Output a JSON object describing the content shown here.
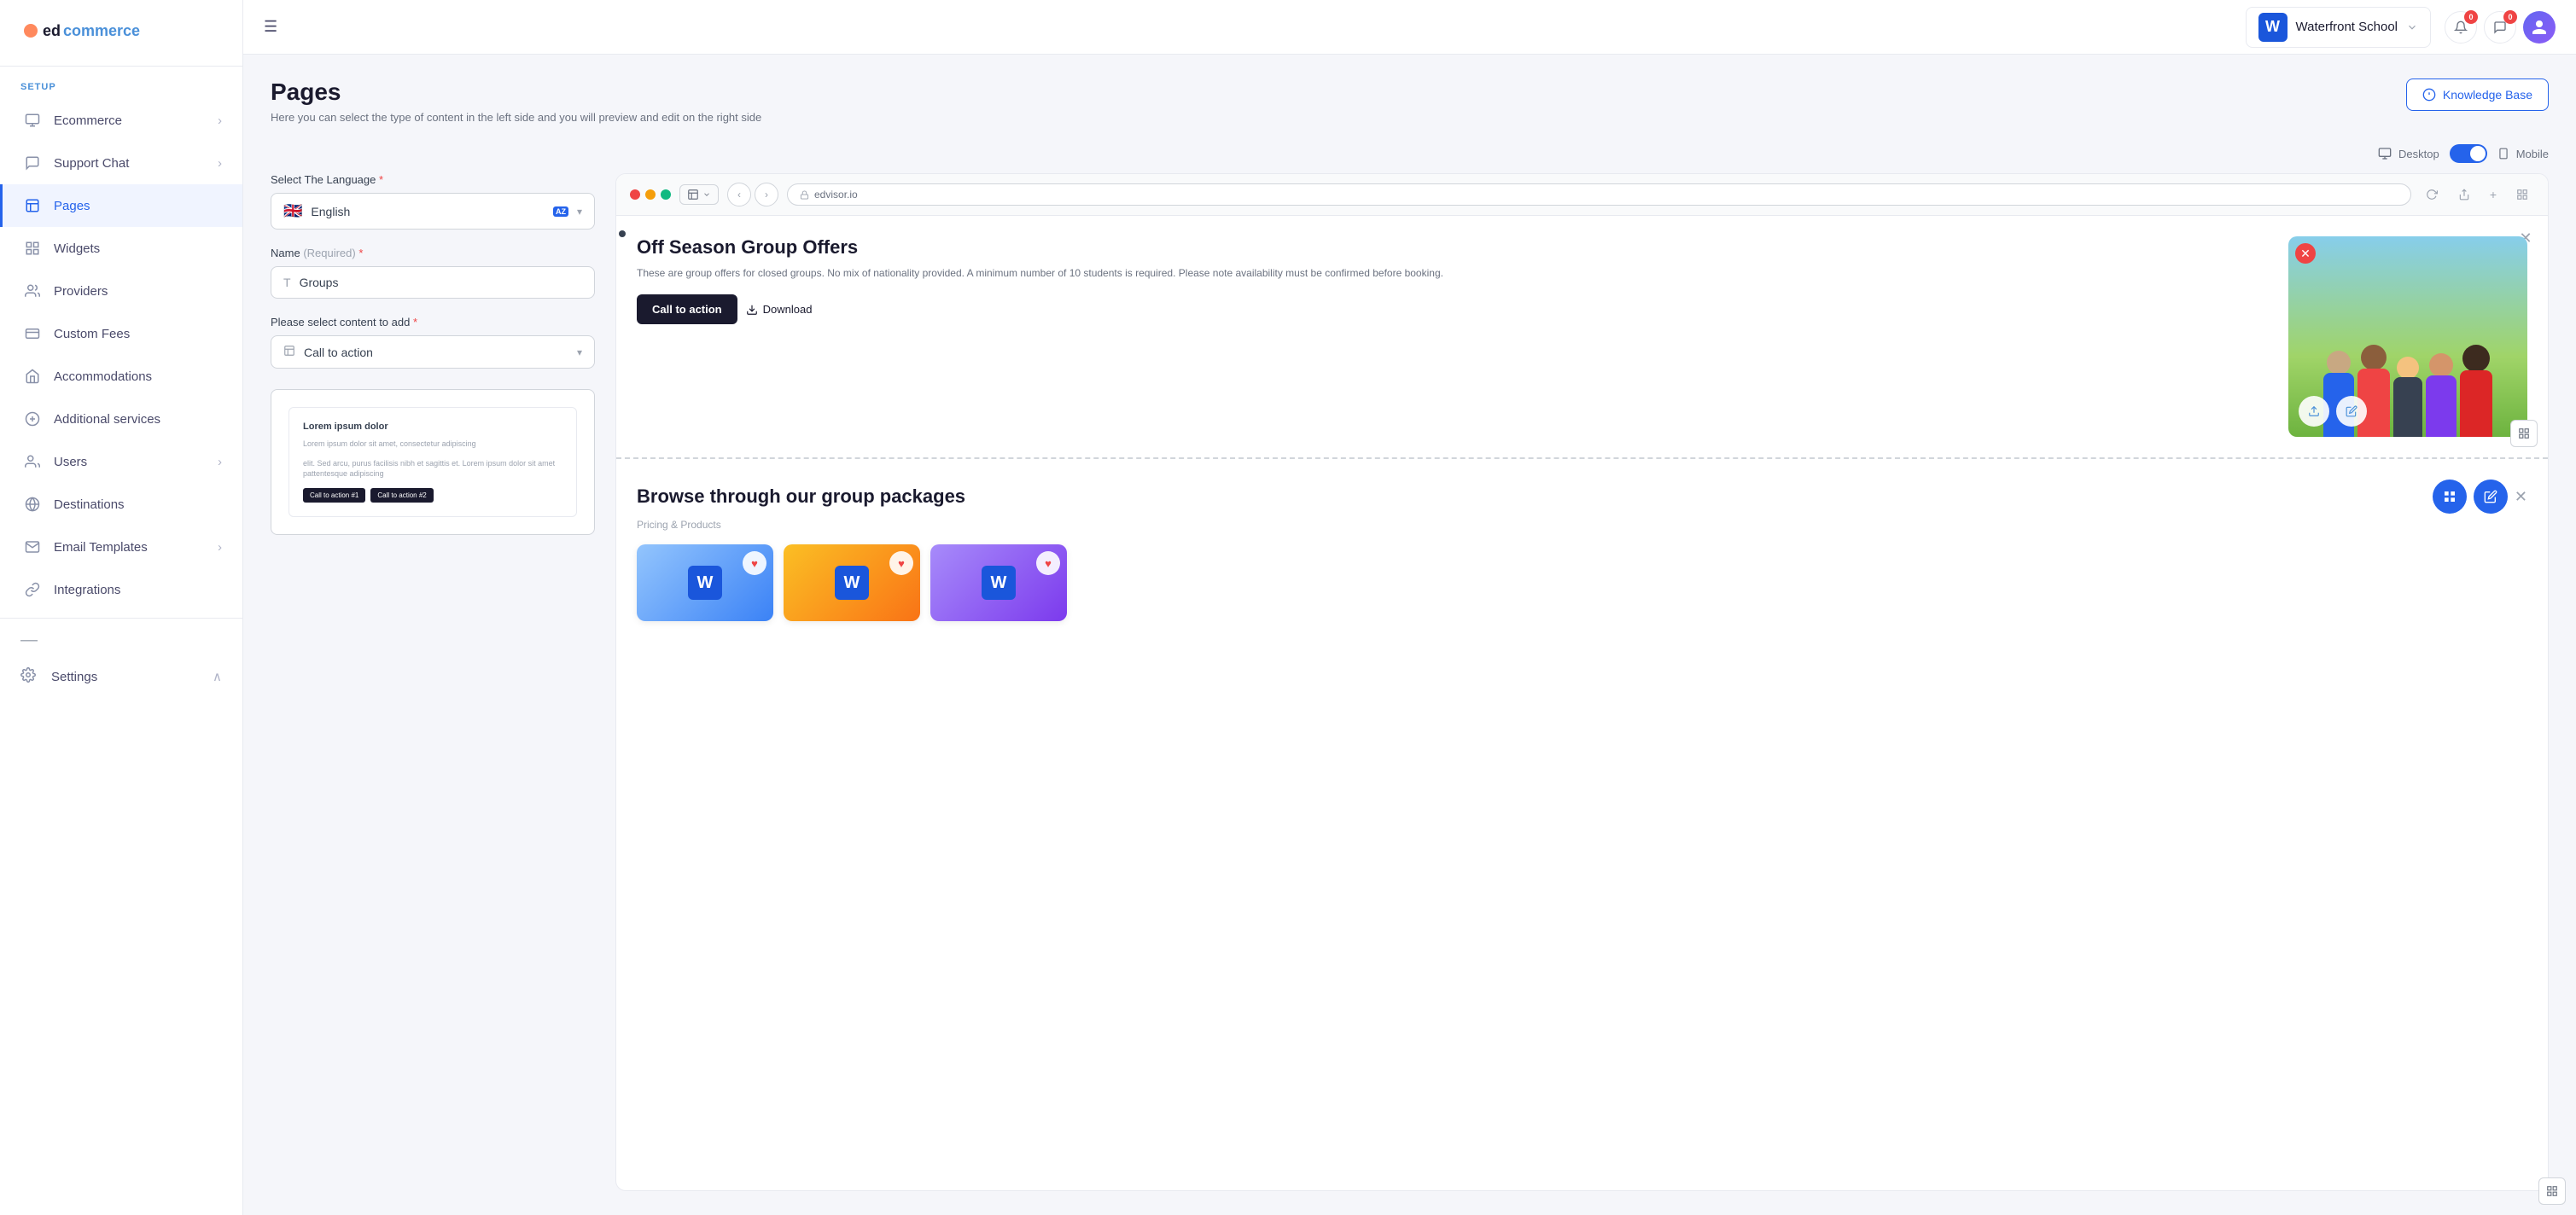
{
  "app": {
    "logo": "edcommerce",
    "logo_accent": "ed"
  },
  "sidebar": {
    "section_label": "SETUP",
    "items": [
      {
        "id": "ecommerce",
        "label": "Ecommerce",
        "has_chevron": true,
        "active": false
      },
      {
        "id": "support-chat",
        "label": "Support Chat",
        "has_chevron": true,
        "active": false
      },
      {
        "id": "pages",
        "label": "Pages",
        "has_chevron": false,
        "active": true
      },
      {
        "id": "widgets",
        "label": "Widgets",
        "has_chevron": false,
        "active": false
      },
      {
        "id": "providers",
        "label": "Providers",
        "has_chevron": false,
        "active": false
      },
      {
        "id": "custom-fees",
        "label": "Custom Fees",
        "has_chevron": false,
        "active": false
      },
      {
        "id": "accommodations",
        "label": "Accommodations",
        "has_chevron": false,
        "active": false
      },
      {
        "id": "additional-services",
        "label": "Additional services",
        "has_chevron": false,
        "active": false
      },
      {
        "id": "users",
        "label": "Users",
        "has_chevron": true,
        "active": false
      },
      {
        "id": "destinations",
        "label": "Destinations",
        "has_chevron": false,
        "active": false
      },
      {
        "id": "email-templates",
        "label": "Email Templates",
        "has_chevron": true,
        "active": false
      },
      {
        "id": "integrations",
        "label": "Integrations",
        "has_chevron": false,
        "active": false
      }
    ],
    "settings_label": "Settings"
  },
  "topbar": {
    "school_name": "Waterfront School",
    "school_initial": "W",
    "notification_count": "0",
    "message_count": "0"
  },
  "page": {
    "title": "Pages",
    "subtitle": "Here you can select the type of content in the left side and you will preview and edit on the right side",
    "knowledge_base_label": "Knowledge Base"
  },
  "view_toggle": {
    "desktop_label": "Desktop",
    "mobile_label": "Mobile"
  },
  "form": {
    "language_label": "Select The Language",
    "language_required": "*",
    "language_value": "English",
    "name_label": "Name",
    "name_sub": "(Required)",
    "name_required": "*",
    "name_value": "Groups",
    "content_label": "Please select content to add",
    "content_required": "*",
    "content_value": "Call to action"
  },
  "browser": {
    "url": "edvisor.io"
  },
  "preview_section1": {
    "title": "Off Season Group Offers",
    "description": "These are group offers for closed groups. No mix of nationality provided. A minimum number of 10 students is required. Please note availability must be confirmed before booking.",
    "cta_label": "Call to action",
    "download_label": "Download"
  },
  "preview_section2": {
    "title": "Browse through our group packages",
    "subtitle": "Pricing & Products"
  },
  "preview_card": {
    "title": "Lorem ipsum dolor",
    "text1": "Lorem ipsum dolor sit amet, consectetur adipiscing",
    "text2": "elit. Sed arcu, purus facilisis nibh et sagittis et. Lorem ipsum dolor sit amet pattentesque adipiscing",
    "btn1": "Call to action #1",
    "btn2": "Call to action #2"
  }
}
